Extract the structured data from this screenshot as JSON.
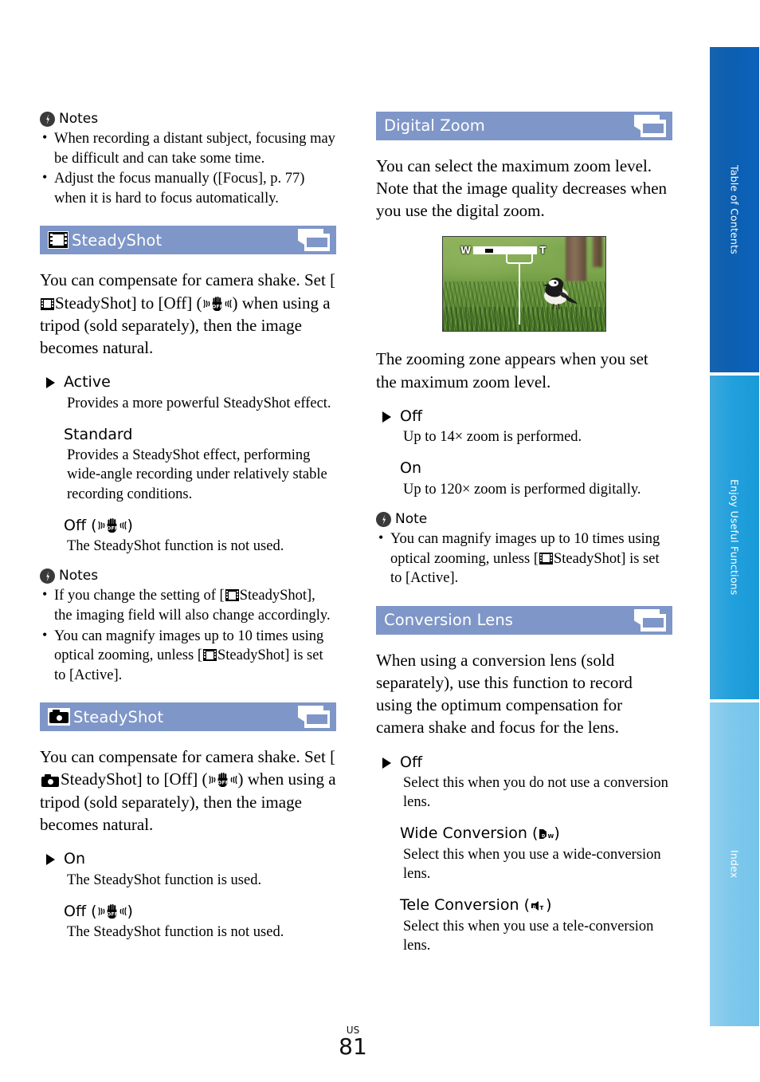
{
  "document": {
    "type": "camera-manual-page",
    "page_number": "81",
    "page_region_code": "US",
    "header_bar_color": "#7f96c8"
  },
  "side_tabs": [
    {
      "label": "Table of Contents",
      "color": "#0d5fb0"
    },
    {
      "label": "Enjoy Useful Functions",
      "color": "#21a0dd"
    },
    {
      "label": "Index",
      "color": "#7ec8ec"
    }
  ],
  "left_column": {
    "notes_top": {
      "heading": "Notes",
      "items": [
        "When recording a distant subject, focusing may be difficult and can take some time.",
        "Adjust the focus manually ([Focus], p. 77) when it is hard to focus automatically."
      ]
    },
    "section_movie_steadyshot": {
      "title": "SteadyShot",
      "lead_icon": "film-strip-icon",
      "trail_icon": "screens-icon",
      "intro_parts": {
        "p1": "You can compensate for camera shake. Set [",
        "p2": "SteadyShot] to [Off] (",
        "p3": ") when using a tripod (sold separately), then the image becomes natural."
      },
      "options": [
        {
          "label": "Active",
          "selected": true,
          "desc": "Provides a more powerful SteadyShot effect."
        },
        {
          "label": "Standard",
          "selected": false,
          "desc": "Provides a SteadyShot effect, performing wide-angle recording under relatively stable recording conditions."
        },
        {
          "label": "Off",
          "label_suffix_icon": "steadyshot-off-icon",
          "selected": false,
          "desc": "The SteadyShot function is not used."
        }
      ],
      "notes": {
        "heading": "Notes",
        "item1_p1": "If you change the setting of [",
        "item1_p2": "SteadyShot], the imaging field will also change accordingly.",
        "item2_p1": "You can magnify images up to 10 times using optical zooming, unless [",
        "item2_p2": "SteadyShot] is set to [Active]."
      }
    },
    "section_photo_steadyshot": {
      "title": "SteadyShot",
      "lead_icon": "camera-icon",
      "trail_icon": "screens-icon",
      "intro_parts": {
        "p1": "You can compensate for camera shake. Set [",
        "p2": "SteadyShot] to [Off] (",
        "p3": ") when using a tripod (sold separately), then the image becomes natural."
      },
      "options": [
        {
          "label": "On",
          "selected": true,
          "desc": "The SteadyShot function is used."
        },
        {
          "label": "Off",
          "label_suffix_icon": "steadyshot-off-icon",
          "selected": false,
          "desc": "The SteadyShot function is not used."
        }
      ]
    }
  },
  "right_column": {
    "section_digital_zoom": {
      "title": "Digital Zoom",
      "trail_icon": "screens-icon",
      "intro": "You can select the maximum zoom level. Note that the image quality decreases when you use the digital zoom.",
      "illustration": {
        "name": "digital-zoom-screen-example",
        "subject": "bird on grass with tree trunk",
        "zoom_bar": {
          "wide_label": "W",
          "tele_label": "T",
          "marker_position_percent": 18,
          "digital_zone_start_percent": 72
        }
      },
      "caption": "The zooming zone appears when you set the maximum zoom level.",
      "options": [
        {
          "label": "Off",
          "selected": true,
          "desc": "Up to 14× zoom is performed."
        },
        {
          "label": "On",
          "selected": false,
          "desc": "Up to 120× zoom is performed digitally."
        }
      ],
      "note": {
        "heading": "Note",
        "item_p1": "You can magnify images up to 10 times using optical zooming, unless [",
        "item_p2": "SteadyShot] is set to [Active]."
      }
    },
    "section_conversion_lens": {
      "title": "Conversion Lens",
      "trail_icon": "screens-icon",
      "intro": "When using a conversion lens (sold separately), use this function to record using the optimum compensation for camera shake and focus for the lens.",
      "options": [
        {
          "label": "Off",
          "selected": true,
          "desc": "Select this when you do not use a conversion lens."
        },
        {
          "label_pre": "Wide Conversion (",
          "label_icon": "wide-conversion-lens-icon",
          "label_post": ")",
          "selected": false,
          "desc": "Select this when you use a wide-conversion lens."
        },
        {
          "label_pre": "Tele Conversion (",
          "label_icon": "tele-conversion-lens-icon",
          "label_post": ")",
          "selected": false,
          "desc": "Select this when you use a tele-conversion lens."
        }
      ]
    }
  }
}
